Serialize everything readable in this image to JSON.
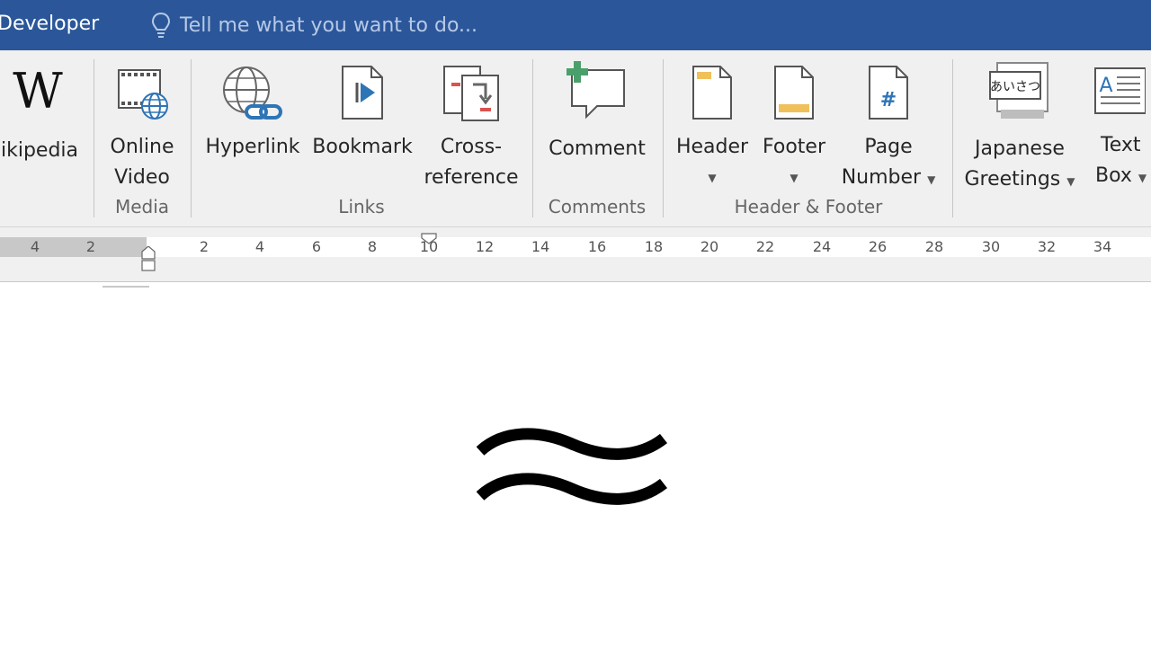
{
  "titlebar": {
    "tab_developer": "Developer",
    "tellme_placeholder": "Tell me what you want to do..."
  },
  "ribbon": {
    "wikipedia": {
      "label": "ikipedia",
      "icon": "wikipedia-icon"
    },
    "media": {
      "group_label": "Media",
      "online_video": {
        "line1": "Online",
        "line2": "Video",
        "icon": "online-video-icon"
      }
    },
    "links": {
      "group_label": "Links",
      "hyperlink": {
        "label": "Hyperlink",
        "icon": "hyperlink-icon"
      },
      "bookmark": {
        "label": "Bookmark",
        "icon": "bookmark-icon"
      },
      "cross_reference": {
        "line1": "Cross-",
        "line2": "reference",
        "icon": "cross-reference-icon"
      }
    },
    "comments": {
      "group_label": "Comments",
      "comment": {
        "label": "Comment",
        "icon": "comment-icon"
      }
    },
    "header_footer": {
      "group_label": "Header & Footer",
      "header": {
        "label": "Header",
        "icon": "header-icon"
      },
      "footer": {
        "label": "Footer",
        "icon": "footer-icon"
      },
      "page_number": {
        "line1": "Page",
        "line2": "Number",
        "icon": "page-number-icon"
      }
    },
    "japanese_greetings": {
      "line1": "Japanese",
      "line2": "Greetings",
      "icon": "japanese-greetings-icon",
      "icon_text": "あいさつ"
    },
    "text_box": {
      "line1": "Text",
      "line2": "Box",
      "icon": "text-box-icon"
    }
  },
  "ruler": {
    "left_numbers": [
      "4",
      "2"
    ],
    "right_numbers": [
      "2",
      "4",
      "6",
      "8",
      "10",
      "12",
      "14",
      "16",
      "18",
      "20",
      "22",
      "24",
      "26",
      "28",
      "30",
      "32",
      "34"
    ]
  },
  "document": {
    "symbol": "≈",
    "symbol_name": "approximately-equal-symbol"
  },
  "colors": {
    "titlebar": "#2b579a",
    "ribbon": "#f0f0f0",
    "accent_blue": "#2e75b6",
    "comment_green": "#4aa06a",
    "header_orange": "#f0c05a",
    "cross_ref_red": "#d9534f"
  }
}
